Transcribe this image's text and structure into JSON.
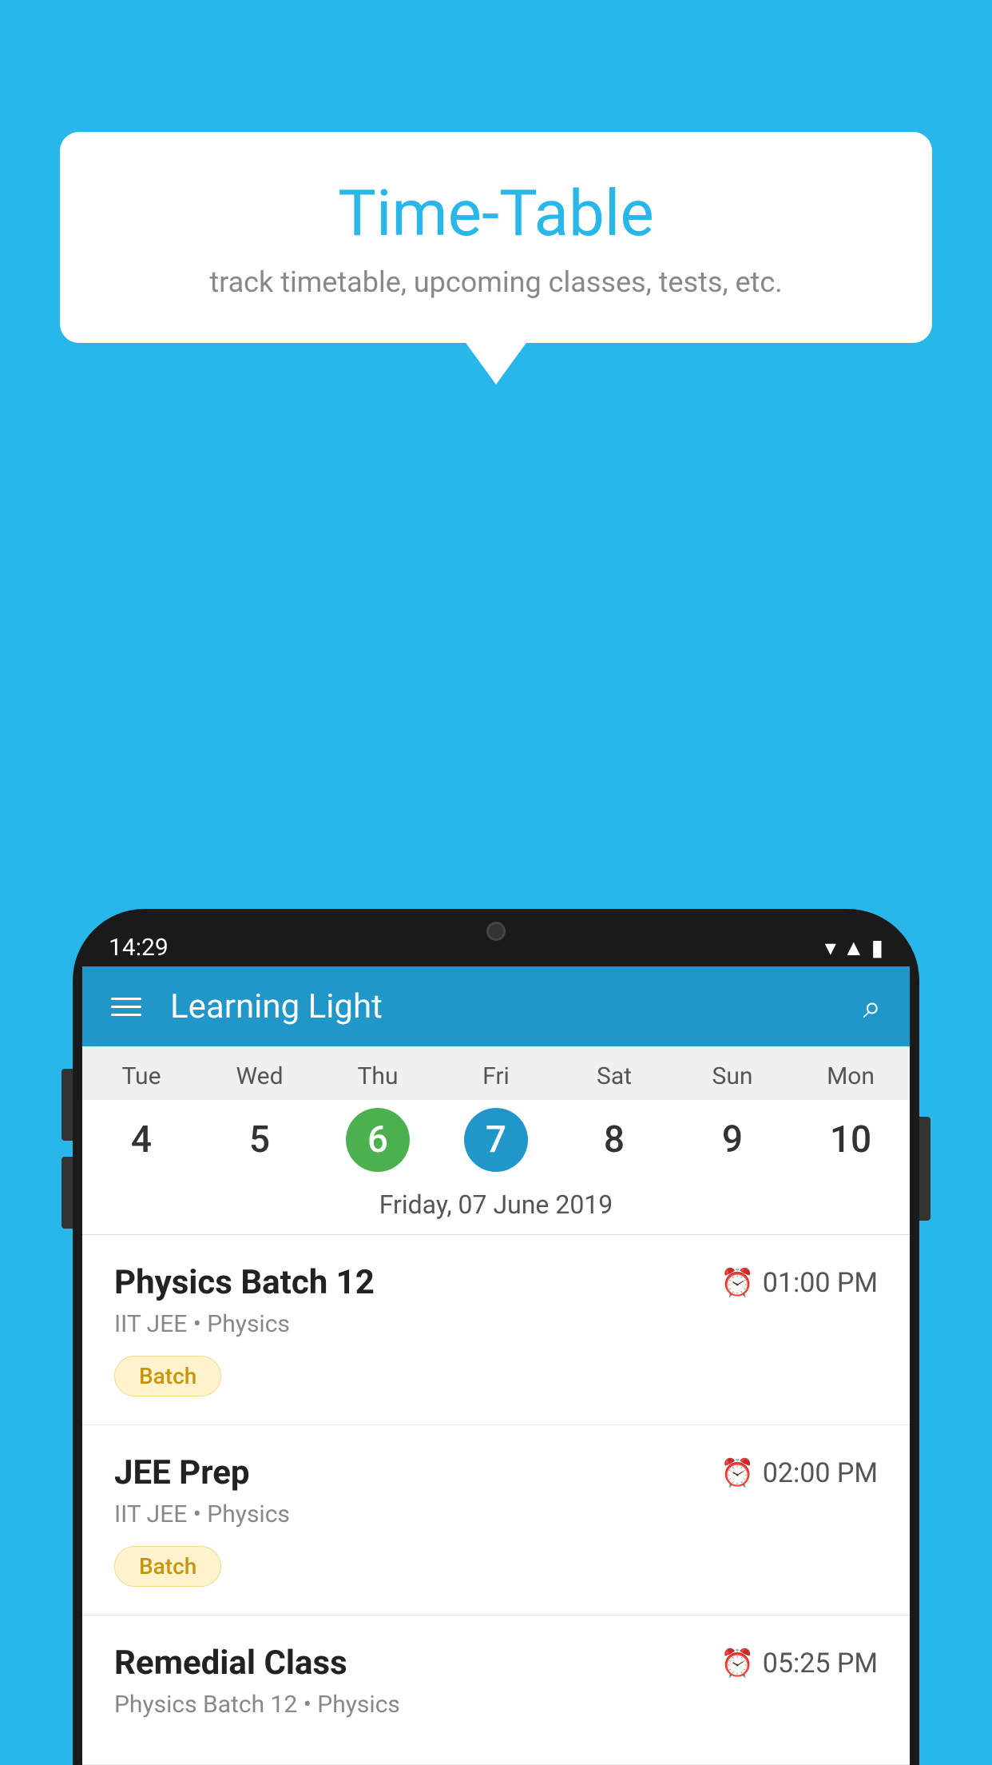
{
  "background_color": "#29B6E8",
  "speech_bubble": {
    "title": "Time-Table",
    "subtitle": "track timetable, upcoming classes, tests, etc."
  },
  "phone": {
    "status_bar": {
      "time": "14:29"
    },
    "app_header": {
      "title": "Learning Light"
    },
    "calendar": {
      "days": [
        "Tue",
        "Wed",
        "Thu",
        "Fri",
        "Sat",
        "Sun",
        "Mon"
      ],
      "dates": [
        "4",
        "5",
        "6",
        "7",
        "8",
        "9",
        "10"
      ],
      "today_index": 2,
      "selected_index": 3,
      "selected_date_label": "Friday, 07 June 2019"
    },
    "schedule": [
      {
        "title": "Physics Batch 12",
        "time": "01:00 PM",
        "subtitle": "IIT JEE • Physics",
        "badge": "Batch"
      },
      {
        "title": "JEE Prep",
        "time": "02:00 PM",
        "subtitle": "IIT JEE • Physics",
        "badge": "Batch"
      },
      {
        "title": "Remedial Class",
        "time": "05:25 PM",
        "subtitle": "Physics Batch 12 • Physics",
        "badge": ""
      }
    ]
  }
}
